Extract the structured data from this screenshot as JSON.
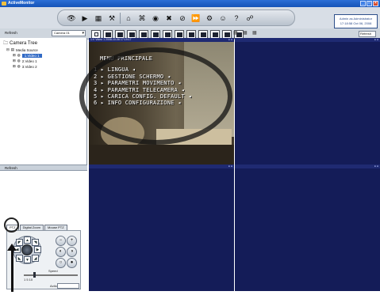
{
  "app": {
    "title": "ActiveMonitor"
  },
  "status": {
    "line1": "Admin as Administrator",
    "line2": "17:18:58 Oct 06, 2008"
  },
  "subbar": {
    "left_label": "Refresh",
    "camera_select_value": "Camera 01",
    "refresh_right": "Refresh"
  },
  "tree": {
    "title": "Camera Tree",
    "root": "Media Source",
    "items": [
      "1.Video 1",
      "2.Video 1",
      "3.Video 2"
    ]
  },
  "bottom_left": {
    "refresh_label": "Refresh"
  },
  "ptz": {
    "tabs": [
      "PTZ",
      "Digital Zoom",
      "Mouse PTZ"
    ],
    "speed_label": "Speed",
    "slider_scale": "1        5        10",
    "action_label": "Action",
    "action_box": "",
    "zoom_label": "Zoom"
  },
  "video1": {
    "header": "1:V  Video 1  2008-10-06 17:19:17",
    "menu_title": "MENU PRINCIPALE",
    "menu_items": [
      "1  ▸ LINGUA                    ◂",
      "2  ▸ GESTIONE SCHERMO          ◂",
      "3  ▸ PARAMETRI MOVIMENTO       ◂",
      "4  ▸ PARAMETRI TELECAMERA      ◂",
      "5  ▸ CARICA CONFIG. DEFAULT    ◂",
      "6  ▸ INFO CONFIGURAZIONE       ◂"
    ]
  },
  "video_headers": {
    "v2": "",
    "v3": "",
    "v4": ""
  },
  "colors": {
    "video_blue": "#141c58",
    "header_blue": "#2b6fd6",
    "selected_tree": "#316ac5"
  }
}
